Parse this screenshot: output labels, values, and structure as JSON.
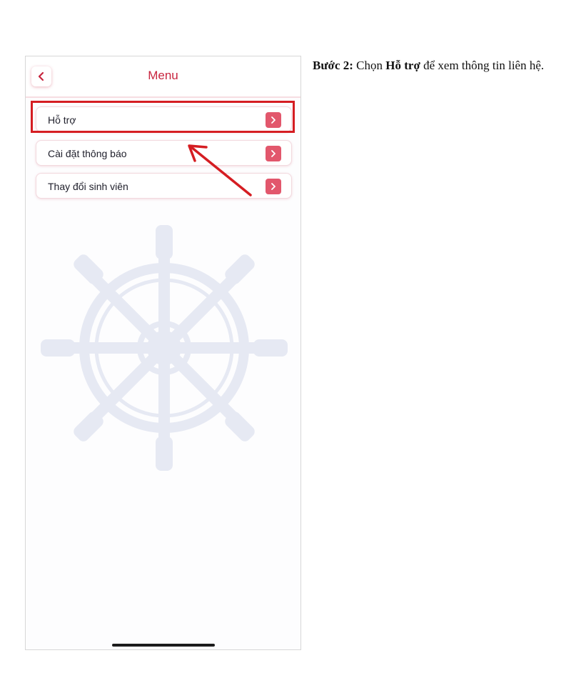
{
  "app": {
    "header": {
      "title": "Menu",
      "back_icon": "chevron-left-icon"
    },
    "menu_items": [
      {
        "label": "Hỗ trợ",
        "icon": "chevron-right-icon"
      },
      {
        "label": "Cài đặt thông báo",
        "icon": "chevron-right-icon"
      },
      {
        "label": "Thay đổi sinh viên",
        "icon": "chevron-right-icon"
      }
    ],
    "watermark_icon": "ship-wheel-icon"
  },
  "annotation": {
    "highlight_color": "#d51d22",
    "arrow_color": "#d51d22"
  },
  "instruction": {
    "step_label": "Bước 2:",
    "text_1": " Chọn ",
    "target": "Hỗ trợ",
    "text_2": " để xem thông tin liên hệ."
  },
  "colors": {
    "accent": "#c8253f",
    "button": "#e2576c"
  }
}
